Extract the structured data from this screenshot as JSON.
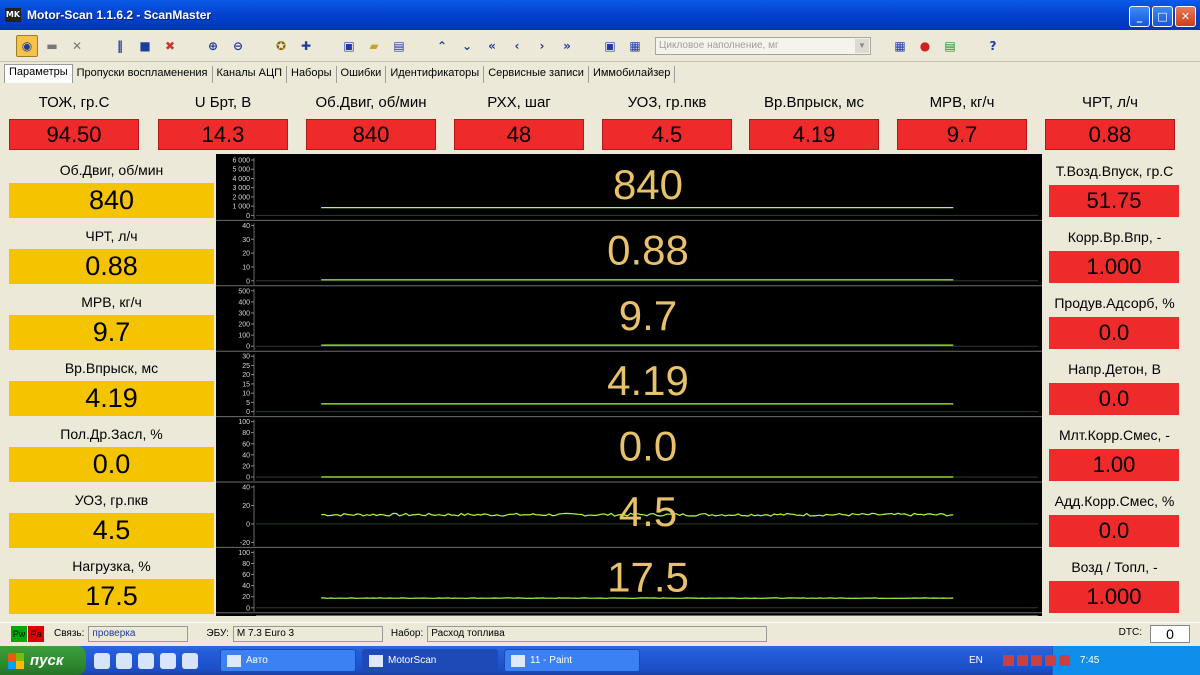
{
  "window": {
    "title": "Motor-Scan 1.1.6.2 - ScanMaster",
    "app_icon_text": "MK"
  },
  "window_controls": {
    "minimize": "_",
    "maximize": "□",
    "close": "✕"
  },
  "toolbar": {
    "combo_value": "Цикловое наполнение, мг",
    "buttons": [
      "connect",
      "engine",
      "tools",
      "pause",
      "stop",
      "clear",
      "zoom-in",
      "zoom-out",
      "wheel",
      "add",
      "save",
      "open",
      "export",
      "up",
      "down",
      "first",
      "prev",
      "next",
      "last",
      "save2",
      "config",
      "list",
      "record",
      "report",
      "help"
    ]
  },
  "tabs": [
    "Параметры",
    "Пропуски воспламенения",
    "Каналы АЦП",
    "Наборы",
    "Ошибки",
    "Идентификаторы",
    "Сервисные записи",
    "Иммобилайзер"
  ],
  "top_params": [
    {
      "label": "ТОЖ, гр.С",
      "value": "94.50"
    },
    {
      "label": "U Брт, В",
      "value": "14.3"
    },
    {
      "label": "Об.Двиг, об/мин",
      "value": "840"
    },
    {
      "label": "РХХ, шаг",
      "value": "48"
    },
    {
      "label": "УОЗ, гр.пкв",
      "value": "4.5"
    },
    {
      "label": "Вр.Впрыск, мс",
      "value": "4.19"
    },
    {
      "label": "МРВ, кг/ч",
      "value": "9.7"
    },
    {
      "label": "ЧРТ, л/ч",
      "value": "0.88"
    }
  ],
  "left_params": [
    {
      "label": "Об.Двиг, об/мин",
      "value": "840"
    },
    {
      "label": "ЧРТ, л/ч",
      "value": "0.88"
    },
    {
      "label": "МРВ, кг/ч",
      "value": "9.7"
    },
    {
      "label": "Вр.Впрыск, мс",
      "value": "4.19"
    },
    {
      "label": "Пол.Др.Засл, %",
      "value": "0.0"
    },
    {
      "label": "УОЗ, гр.пкв",
      "value": "4.5"
    },
    {
      "label": "Нагрузка, %",
      "value": "17.5"
    }
  ],
  "right_params": [
    {
      "label": "Т.Возд.Впуск, гр.С",
      "value": "51.75"
    },
    {
      "label": "Корр.Вр.Впр, -",
      "value": "1.000"
    },
    {
      "label": "Продув.Адсорб, %",
      "value": "0.0"
    },
    {
      "label": "Напр.Детон, В",
      "value": "0.0"
    },
    {
      "label": "Млт.Корр.Смес, -",
      "value": "1.00"
    },
    {
      "label": "Адд.Корр.Смес, %",
      "value": "0.0"
    },
    {
      "label": "Возд / Топл, -",
      "value": "1.000"
    }
  ],
  "chart_data": {
    "type": "line",
    "x_ticks": [
      "524",
      "526",
      "528",
      "530",
      "532",
      "534",
      "536",
      "538",
      "540",
      "542",
      "544",
      "546",
      "548",
      "550",
      "552",
      "554",
      "556",
      "558",
      "560",
      "562",
      "564",
      "566",
      "568",
      "570",
      "572",
      "574",
      "576",
      "578",
      "580",
      "582"
    ],
    "xlim": [
      523,
      583
    ],
    "data_x_range": [
      528,
      576.5
    ],
    "line_color": "#a8ff3c",
    "value_color": "#e8c26a",
    "series": [
      {
        "current": "840",
        "ylim": [
          0,
          6000
        ],
        "y_ticks": [
          "6 000",
          "5 000",
          "4 000",
          "3 000",
          "2 000",
          "1 000",
          "0"
        ],
        "level": 840,
        "noise": 0
      },
      {
        "current": "0.88",
        "ylim": [
          0,
          50
        ],
        "y_ticks": [
          "40",
          "30",
          "20",
          "10",
          "0"
        ],
        "level": 0.88,
        "noise": 0
      },
      {
        "current": "9.7",
        "ylim": [
          0,
          500
        ],
        "y_ticks": [
          "500",
          "400",
          "300",
          "200",
          "100",
          "0"
        ],
        "level": 9.7,
        "noise": 0
      },
      {
        "current": "4.19",
        "ylim": [
          0,
          30
        ],
        "y_ticks": [
          "30",
          "25",
          "20",
          "15",
          "10",
          "5",
          "0"
        ],
        "level": 4.19,
        "noise": 0
      },
      {
        "current": "0.0",
        "ylim": [
          0,
          100
        ],
        "y_ticks": [
          "100",
          "80",
          "60",
          "40",
          "20",
          "0"
        ],
        "level": 0,
        "noise": 0
      },
      {
        "current": "4.5",
        "ylim": [
          -20,
          40
        ],
        "y_ticks": [
          "40",
          "20",
          "0",
          "-20"
        ],
        "level": 10,
        "noise": 1.5
      },
      {
        "current": "17.5",
        "ylim": [
          0,
          100
        ],
        "y_ticks": [
          "100",
          "80",
          "60",
          "40",
          "20",
          "0"
        ],
        "level": 17.5,
        "noise": 0.4
      }
    ]
  },
  "status": {
    "pw": "Pw",
    "pa": "Pa",
    "link_label": "Связь:",
    "link_value": "проверка",
    "ecu_label": "ЭБУ:",
    "ecu_value": "M 7.3 Euro 3",
    "set_label": "Набор:",
    "set_value": "Расход топлива",
    "dtc_label": "DTC:",
    "dtc_value": "0"
  },
  "taskbar": {
    "start_label": "пуск",
    "tasks": [
      {
        "label": "Авто",
        "active": false
      },
      {
        "label": "MotorScan",
        "active": true
      },
      {
        "label": "11 - Paint",
        "active": false
      }
    ],
    "lang": "EN",
    "time": "7:45"
  }
}
